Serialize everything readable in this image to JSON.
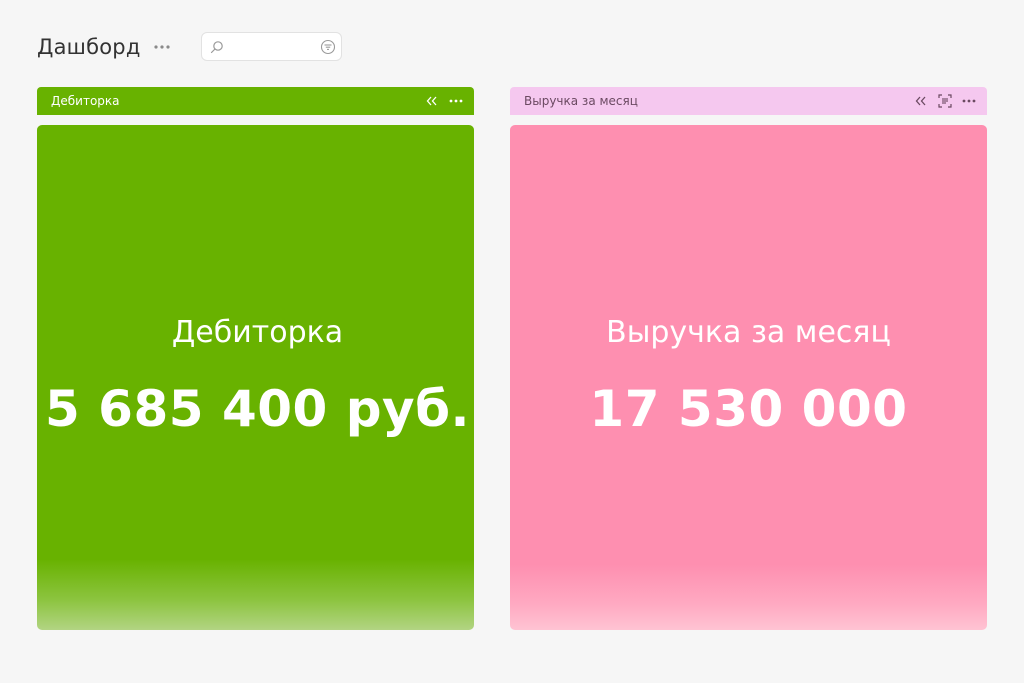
{
  "page": {
    "title": "Дашборд"
  },
  "search": {
    "value": "",
    "placeholder": ""
  },
  "colors": {
    "accent_left": "#68b200",
    "accent_right": "#fe8fb0",
    "accent_right_header": "#f5c8ef",
    "background": "#f6f6f6"
  },
  "widgets": [
    {
      "header_title": "Дебиторка",
      "label": "Дебиторка",
      "value": "5 685 400 руб."
    },
    {
      "header_title": "Выручка за месяц",
      "label": "Выручка за месяц",
      "value": "17 530 000"
    }
  ],
  "icons": {
    "page_menu": "more-horizontal-icon",
    "search": "search-icon",
    "filter": "filter-icon",
    "collapse": "collapse-left-icon",
    "fullscreen": "focus-frame-icon",
    "widget_menu": "more-horizontal-icon"
  }
}
